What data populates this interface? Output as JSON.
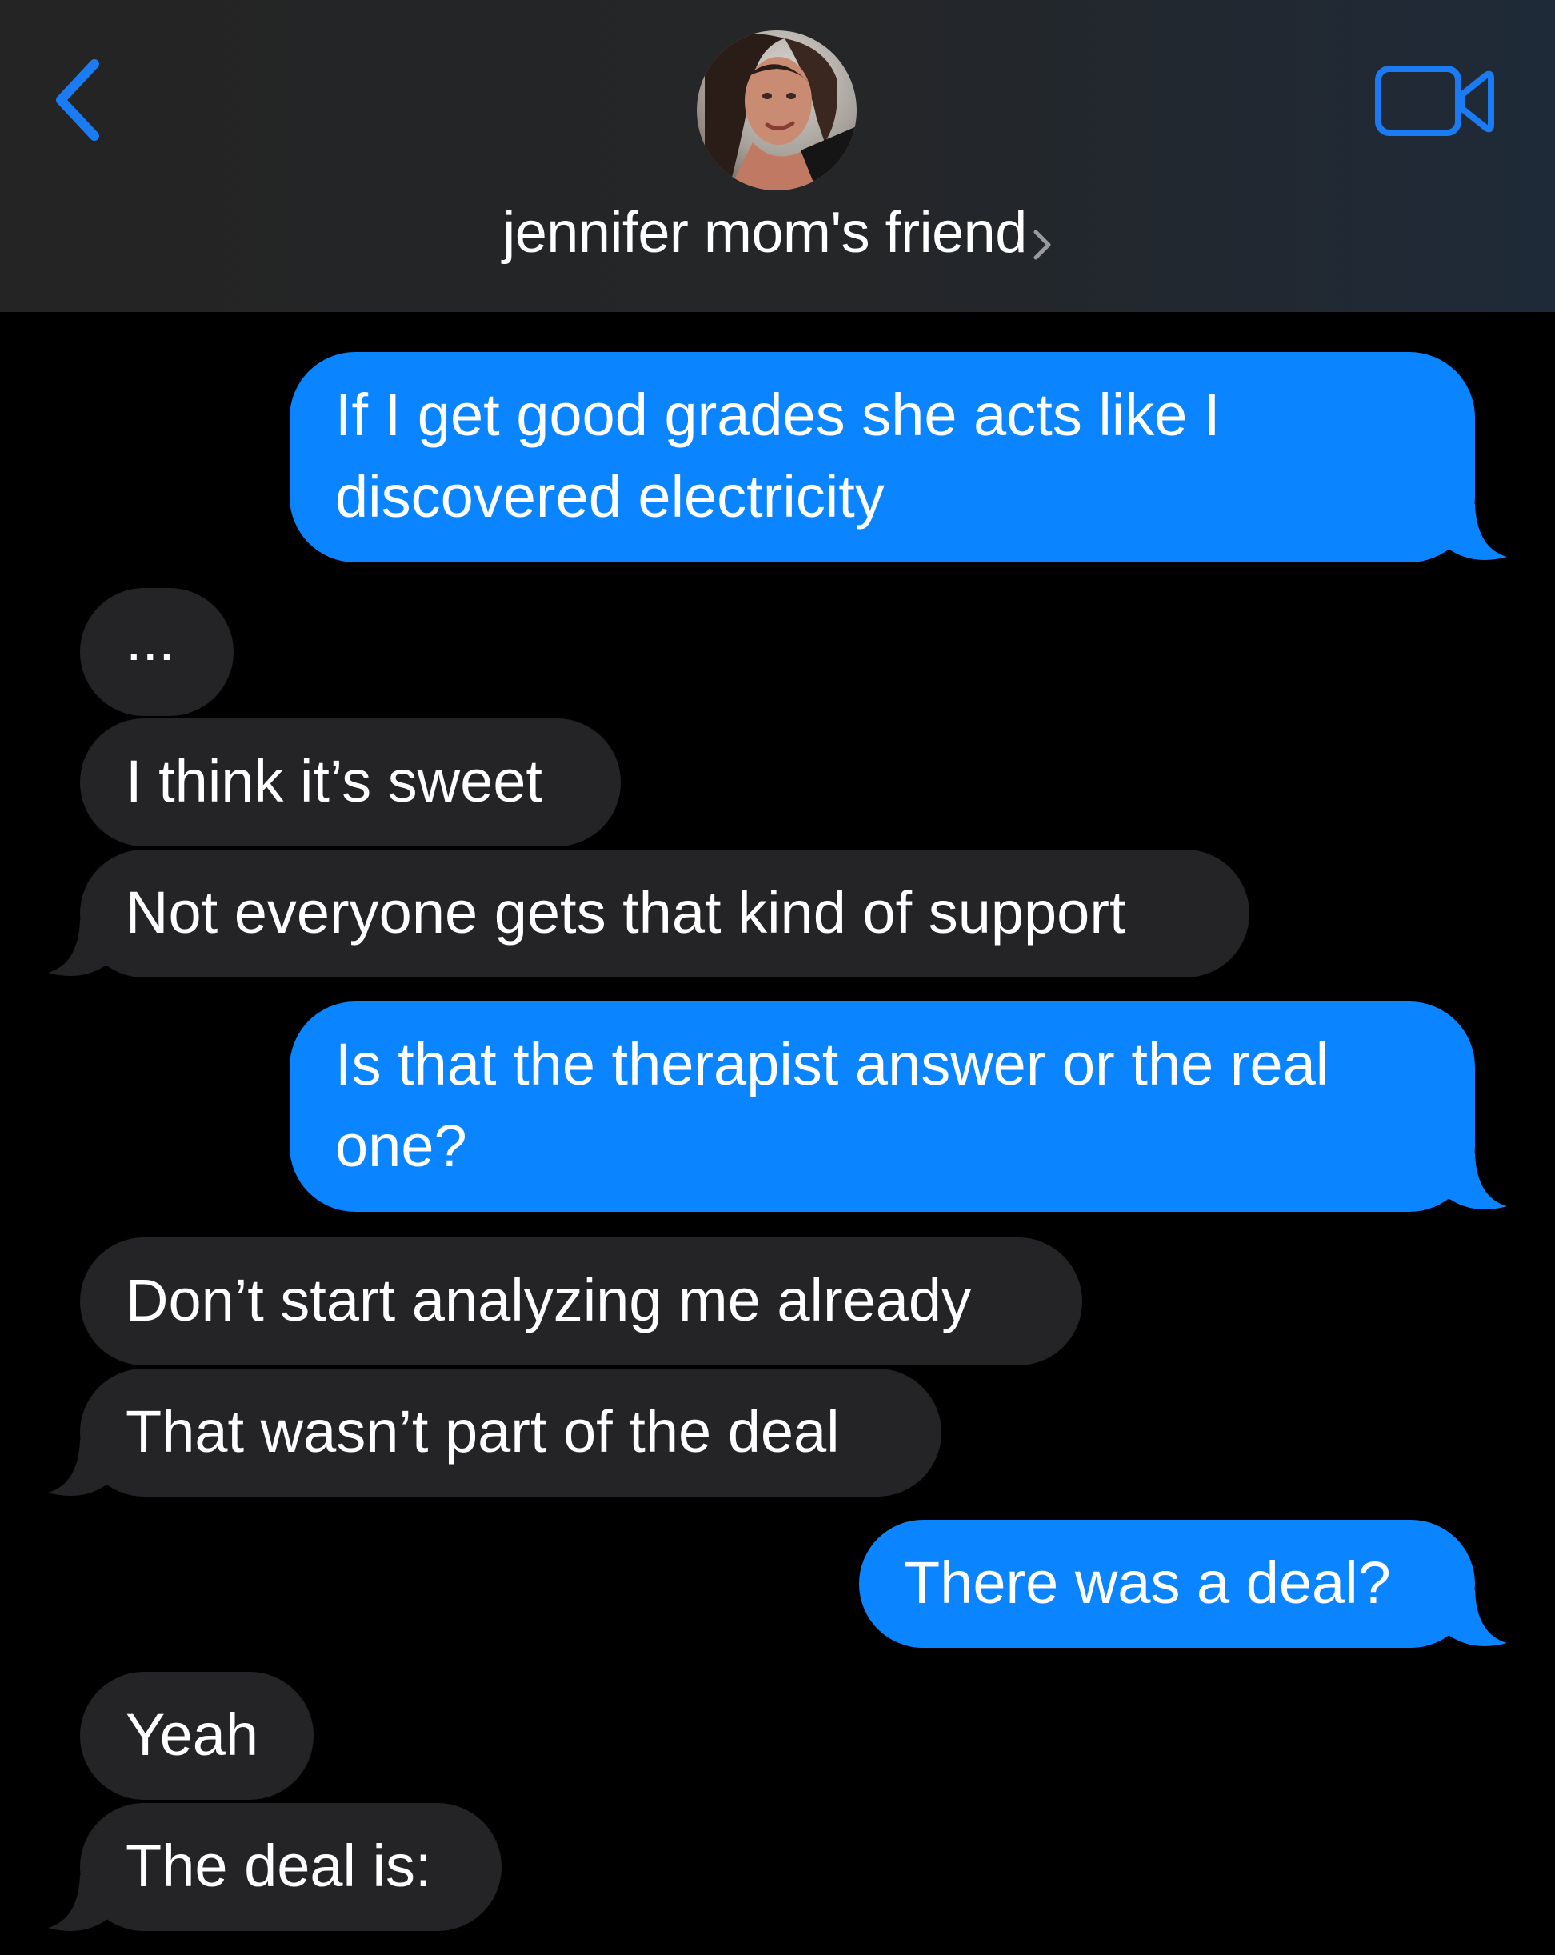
{
  "header": {
    "contact_name": "jennifer mom's friend",
    "back_icon": "chevron-left-icon",
    "video_icon": "video-camera-icon",
    "avatar_icon": "contact-avatar-photo"
  },
  "colors": {
    "outgoing_bubble": "#0a84ff",
    "incoming_bubble": "#242426",
    "accent": "#1a7bf2",
    "background": "#000000"
  },
  "messages": [
    {
      "direction": "outgoing",
      "text": "If I get good grades she acts like I discovered electricity"
    },
    {
      "direction": "incoming",
      "text": "..."
    },
    {
      "direction": "incoming",
      "text": "I think it’s sweet"
    },
    {
      "direction": "incoming",
      "text": "Not everyone gets that kind of support"
    },
    {
      "direction": "outgoing",
      "text": "Is that the therapist answer or the real one?"
    },
    {
      "direction": "incoming",
      "text": "Don’t start analyzing me already"
    },
    {
      "direction": "incoming",
      "text": "That wasn’t part of the deal"
    },
    {
      "direction": "outgoing",
      "text": "There was a deal?"
    },
    {
      "direction": "incoming",
      "text": "Yeah"
    },
    {
      "direction": "incoming",
      "text": "The deal is:"
    }
  ]
}
